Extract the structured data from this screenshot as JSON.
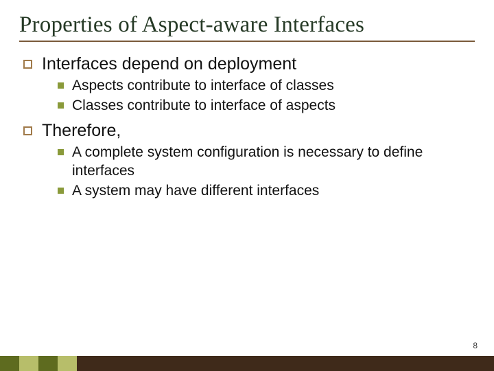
{
  "title": "Properties of Aspect-aware Interfaces",
  "points": [
    {
      "label": "Interfaces depend on deployment",
      "sub": [
        "Aspects contribute to interface of classes",
        "Classes contribute to interface of aspects"
      ]
    },
    {
      "label": "Therefore,",
      "sub": [
        "A complete system configuration is necessary to define interfaces",
        "A system may have different interfaces"
      ]
    }
  ],
  "page_number": "8"
}
